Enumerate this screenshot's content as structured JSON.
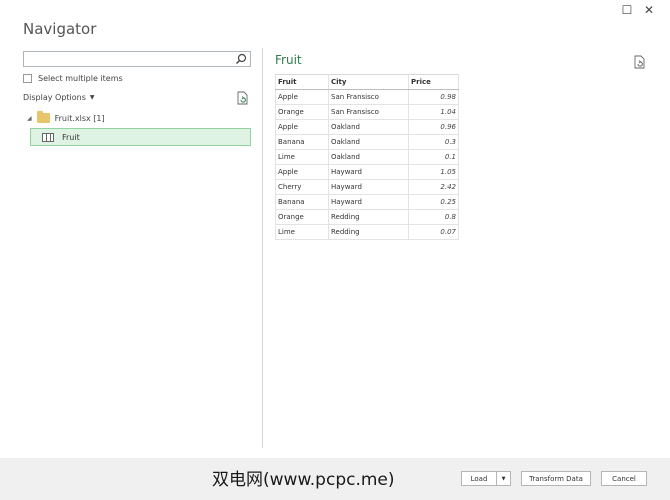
{
  "window": {
    "title": "Navigator",
    "minimize_glyph": "☐",
    "close_glyph": "✕"
  },
  "left": {
    "search_placeholder": "",
    "select_multiple": "Select multiple items",
    "display_options": "Display Options",
    "tree": {
      "file": "Fruit.xlsx [1]",
      "items": [
        {
          "label": "Fruit"
        }
      ]
    }
  },
  "preview": {
    "title": "Fruit",
    "columns": [
      "Fruit",
      "City",
      "Price"
    ],
    "rows": [
      [
        "Apple",
        "San Fransisco",
        "0.98"
      ],
      [
        "Orange",
        "San Fransisco",
        "1.04"
      ],
      [
        "Apple",
        "Oakland",
        "0.96"
      ],
      [
        "Banana",
        "Oakland",
        "0.3"
      ],
      [
        "Lime",
        "Oakland",
        "0.1"
      ],
      [
        "Apple",
        "Hayward",
        "1.05"
      ],
      [
        "Cherry",
        "Hayward",
        "2.42"
      ],
      [
        "Banana",
        "Hayward",
        "0.25"
      ],
      [
        "Orange",
        "Redding",
        "0.8"
      ],
      [
        "Lime",
        "Redding",
        "0.07"
      ]
    ]
  },
  "footer": {
    "watermark": "双电网(www.pcpc.me)",
    "load": "Load",
    "transform": "Transform Data",
    "cancel": "Cancel"
  },
  "colors": {
    "accent_green": "#2e7d4f",
    "selected_bg": "#dff3e4",
    "selected_border": "#93d3a2"
  }
}
